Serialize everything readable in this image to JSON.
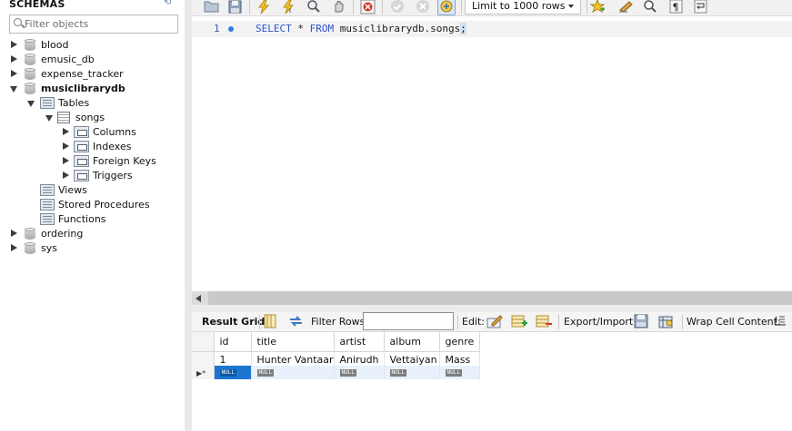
{
  "navigator": {
    "header": "SCHEMAS",
    "filter_placeholder": "Filter objects",
    "tree": [
      {
        "label": "blood",
        "level": 0,
        "type": "schema",
        "expanded": false
      },
      {
        "label": "emusic_db",
        "level": 0,
        "type": "schema",
        "expanded": false
      },
      {
        "label": "expense_tracker",
        "level": 0,
        "type": "schema",
        "expanded": false
      },
      {
        "label": "musiclibrarydb",
        "level": 0,
        "type": "schema",
        "expanded": true,
        "bold": true
      },
      {
        "label": "Tables",
        "level": 1,
        "type": "folder",
        "expanded": true
      },
      {
        "label": "songs",
        "level": 2,
        "type": "table",
        "expanded": true
      },
      {
        "label": "Columns",
        "level": 3,
        "type": "sub",
        "expanded": false
      },
      {
        "label": "Indexes",
        "level": 3,
        "type": "sub",
        "expanded": false
      },
      {
        "label": "Foreign Keys",
        "level": 3,
        "type": "sub",
        "expanded": false
      },
      {
        "label": "Triggers",
        "level": 3,
        "type": "sub",
        "expanded": false
      },
      {
        "label": "Views",
        "level": 1,
        "type": "folder",
        "expanded": null
      },
      {
        "label": "Stored Procedures",
        "level": 1,
        "type": "folder",
        "expanded": null
      },
      {
        "label": "Functions",
        "level": 1,
        "type": "folder",
        "expanded": null
      },
      {
        "label": "ordering",
        "level": 0,
        "type": "schema",
        "expanded": false
      },
      {
        "label": "sys",
        "level": 0,
        "type": "schema",
        "expanded": false
      }
    ]
  },
  "toolbar": {
    "limit_value": "Limit to 1000 rows",
    "icons": [
      "open-folder-icon",
      "save-icon",
      "execute-icon",
      "execute-current-icon",
      "explain-icon",
      "stop-icon",
      "toggle-error-icon",
      "commit-icon",
      "rollback-icon",
      "autocommit-icon",
      "bookmark-star-icon",
      "beautify-icon",
      "find-icon",
      "invisible-chars-icon",
      "wrap-lines-icon"
    ]
  },
  "editor": {
    "line_number": "1",
    "sql_keyword_select": "SELECT",
    "sql_star": " * ",
    "sql_keyword_from": "FROM",
    "sql_target": " musiclibrarydb.songs",
    "sql_terminator": ";"
  },
  "result_toolbar": {
    "title": "Result Grid",
    "filter_label": "Filter Rows:",
    "filter_value": "",
    "edit_label": "Edit:",
    "export_label": "Export/Import:",
    "wrap_label": "Wrap Cell Content:"
  },
  "grid": {
    "columns": [
      "id",
      "title",
      "artist",
      "album",
      "genre"
    ],
    "rows": [
      [
        "1",
        "Hunter Vantaar",
        "Anirudh",
        "Vettaiyan",
        "Mass"
      ]
    ],
    "new_row_marker": "▶*",
    "null_text": "NULL"
  }
}
